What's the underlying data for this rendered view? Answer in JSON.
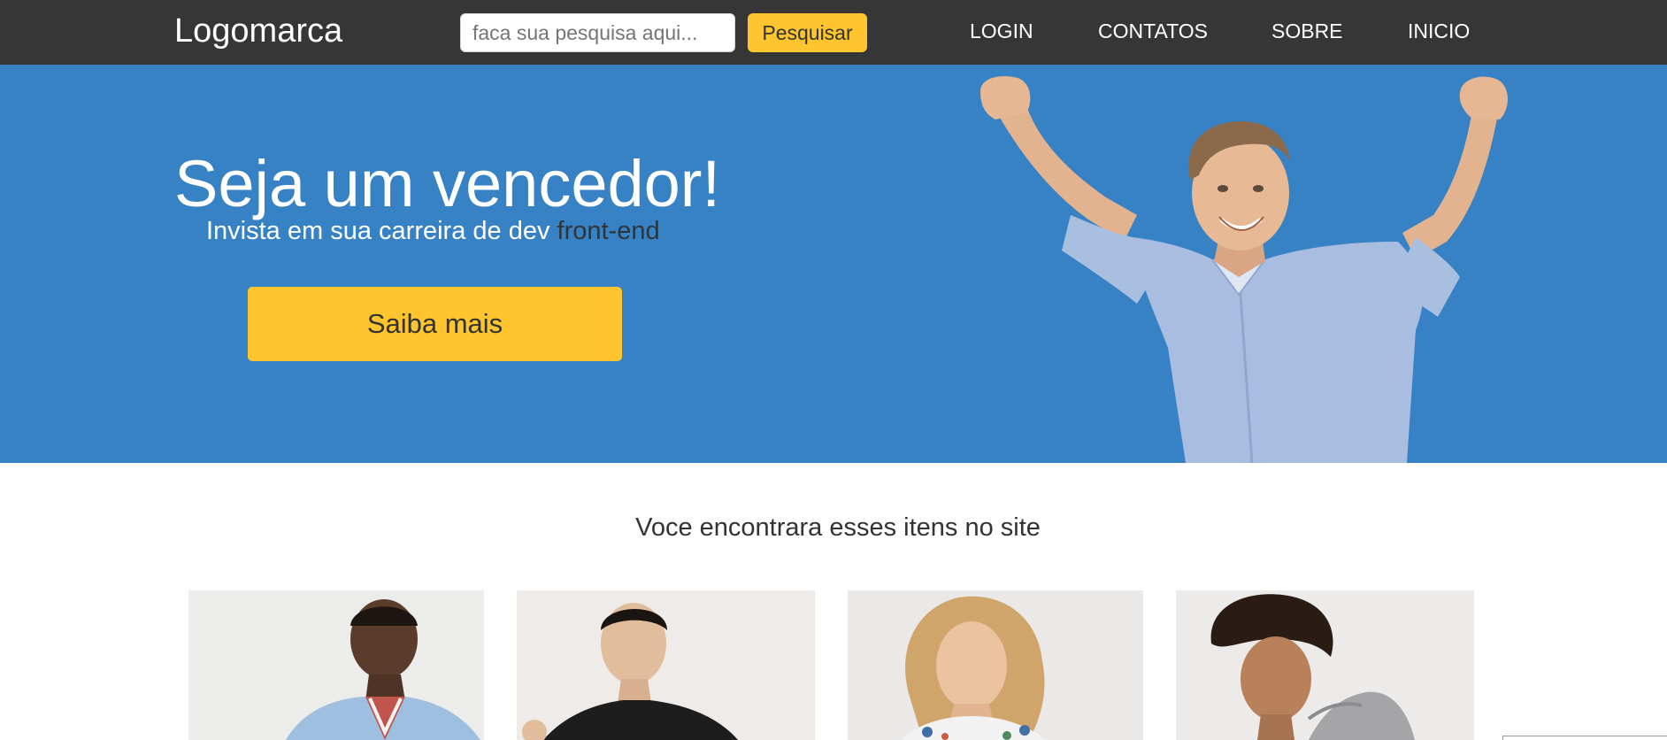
{
  "navbar": {
    "logo": "Logomarca",
    "search": {
      "placeholder": "faca sua pesquisa aqui...",
      "value": "",
      "button_label": "Pesquisar"
    },
    "links": [
      "LOGIN",
      "CONTATOS",
      "SOBRE",
      "INICIO"
    ]
  },
  "hero": {
    "title": "Seja um vencedor!",
    "subtitle_main": "Invista em sua carreira de dev ",
    "subtitle_accent": "front-end",
    "cta_label": "Saiba mais",
    "image": "man-arms-raised-photo"
  },
  "section": {
    "title": "Voce encontrara esses itens no site",
    "cards": [
      {
        "image": "model-photo-1"
      },
      {
        "image": "model-photo-2"
      },
      {
        "image": "model-photo-3"
      },
      {
        "image": "model-photo-4"
      }
    ]
  },
  "colors": {
    "navbar_bg": "#363636",
    "hero_bg": "#3782c4",
    "accent_yellow": "#fec52e",
    "text_dark": "#333333",
    "white": "#ffffff"
  }
}
